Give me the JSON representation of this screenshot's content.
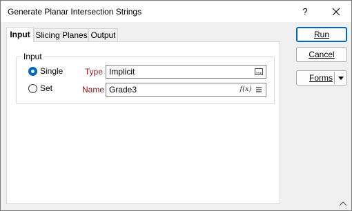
{
  "window": {
    "title": "Generate Planar Intersection Strings",
    "help_label": "?",
    "close_icon": "close-icon"
  },
  "tabs": [
    {
      "label": "Input",
      "active": true
    },
    {
      "label": "Slicing Planes",
      "active": false
    },
    {
      "label": "Output",
      "active": false
    }
  ],
  "input_group": {
    "label": "Input",
    "radio_single": {
      "label": "Single",
      "checked": true
    },
    "radio_set": {
      "label": "Set",
      "checked": false
    },
    "type": {
      "label": "Type",
      "value": "Implicit",
      "button_icon": "ellipsis-icon"
    },
    "name": {
      "label": "Name",
      "value": "Grade3",
      "fx_label": "f(x)",
      "list_icon": "list-icon"
    }
  },
  "buttons": {
    "run": "Run",
    "cancel": "Cancel",
    "forms": "Forms",
    "forms_dropdown_icon": "chevron-down-icon"
  },
  "colors": {
    "accent": "#0067c0",
    "label_red": "#8b1a1a"
  }
}
